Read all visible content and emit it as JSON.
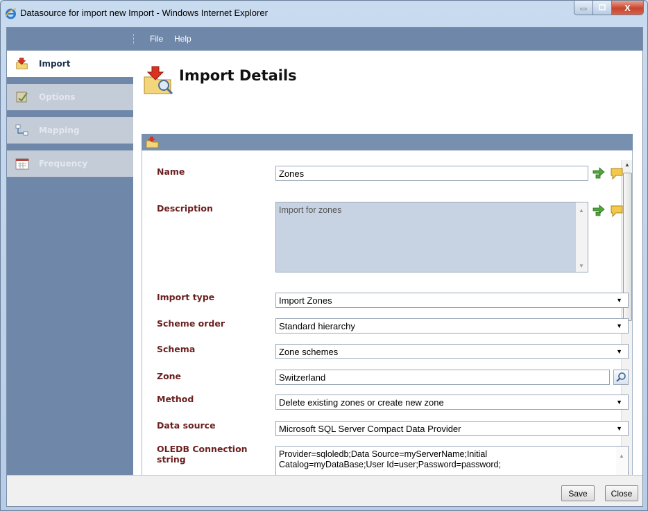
{
  "window": {
    "title": "Datasource for import new Import - Windows Internet Explorer",
    "close_glyph": "X"
  },
  "menu": {
    "items": [
      {
        "label": "File"
      },
      {
        "label": "Help"
      }
    ]
  },
  "sidebar": {
    "items": [
      {
        "label": "Import",
        "icon": "import-icon",
        "active": true
      },
      {
        "label": "Options",
        "icon": "options-icon",
        "active": false
      },
      {
        "label": "Mapping",
        "icon": "mapping-icon",
        "active": false
      },
      {
        "label": "Frequency",
        "icon": "frequency-icon",
        "active": false
      }
    ]
  },
  "page": {
    "title": "Import Details"
  },
  "form": {
    "name": {
      "label": "Name",
      "value": "Zones"
    },
    "description": {
      "label": "Description",
      "value": "Import for zones"
    },
    "import_type": {
      "label": "Import type",
      "value": "Import Zones"
    },
    "scheme_order": {
      "label": "Scheme order",
      "value": "Standard hierarchy"
    },
    "schema": {
      "label": "Schema",
      "value": "Zone schemes"
    },
    "zone": {
      "label": "Zone",
      "value": "Switzerland"
    },
    "method": {
      "label": "Method",
      "value": "Delete existing zones or create new zone"
    },
    "data_source": {
      "label": "Data source",
      "value": "Microsoft SQL Server Compact Data Provider"
    },
    "oledb": {
      "label_line1": "OLEDB Connection",
      "label_line2": "string",
      "value_line1": "Provider=sqloledb;Data Source=myServerName;Initial",
      "value_line2": "Catalog=myDataBase;User Id=user;Password=password;"
    }
  },
  "footer": {
    "save_label": "Save",
    "close_label": "Close"
  },
  "colors": {
    "nav_bg": "#6f87a8",
    "label_color": "#6b1f1f",
    "panel_header": "#7890b0",
    "disabled_field": "#c7d3e3"
  }
}
